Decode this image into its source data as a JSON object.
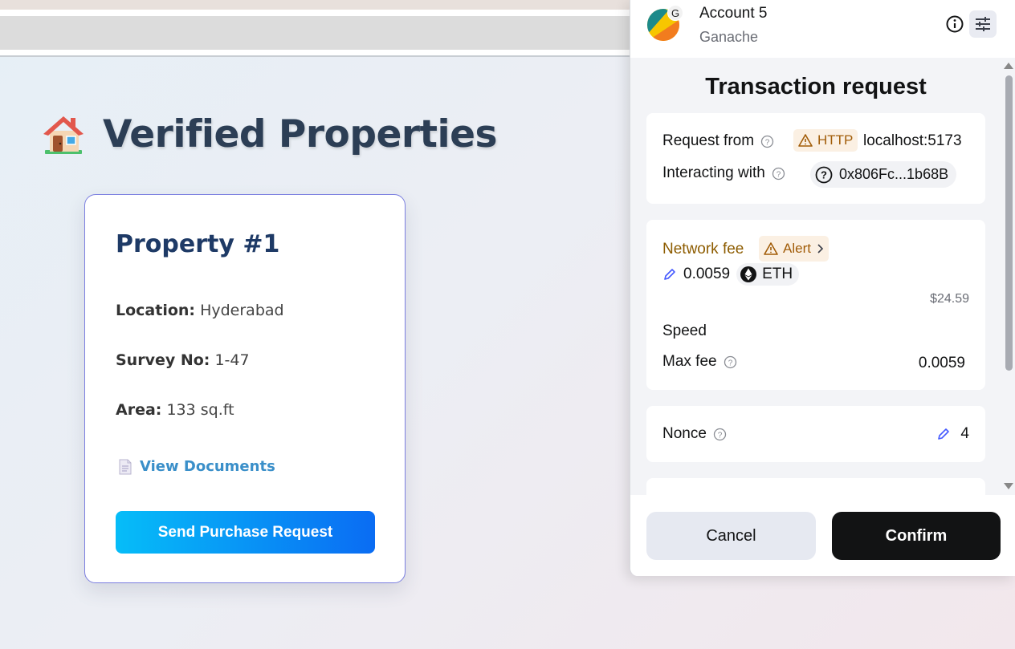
{
  "page": {
    "title": "Verified Properties"
  },
  "card": {
    "title": "Property #1",
    "location_label": "Location:",
    "location_value": "Hyderabad",
    "survey_label": "Survey No:",
    "survey_value": "1-47",
    "area_label": "Area:",
    "area_value": "133 sq.ft",
    "docs_link": "View Documents",
    "send_button": "Send Purchase Request"
  },
  "popup": {
    "account_name": "Account 5",
    "network_name": "Ganache",
    "network_badge": "G",
    "title": "Transaction request",
    "request_from_label": "Request from",
    "http_badge": "HTTP",
    "host": "localhost:5173",
    "interacting_label": "Interacting with",
    "contract_address": "0x806Fc...1b68B",
    "network_fee_label": "Network fee",
    "alert_label": "Alert",
    "fee_value": "0.0059",
    "fee_currency": "ETH",
    "fee_usd": "$24.59",
    "speed_label": "Speed",
    "max_fee_label": "Max fee",
    "max_fee_value": "0.0059",
    "nonce_label": "Nonce",
    "nonce_value": "4",
    "cancel_button": "Cancel",
    "confirm_button": "Confirm"
  },
  "colors": {
    "accent_blue": "#0a6cf3",
    "warning": "#a15c08",
    "title_dark": "#2c3e55"
  }
}
